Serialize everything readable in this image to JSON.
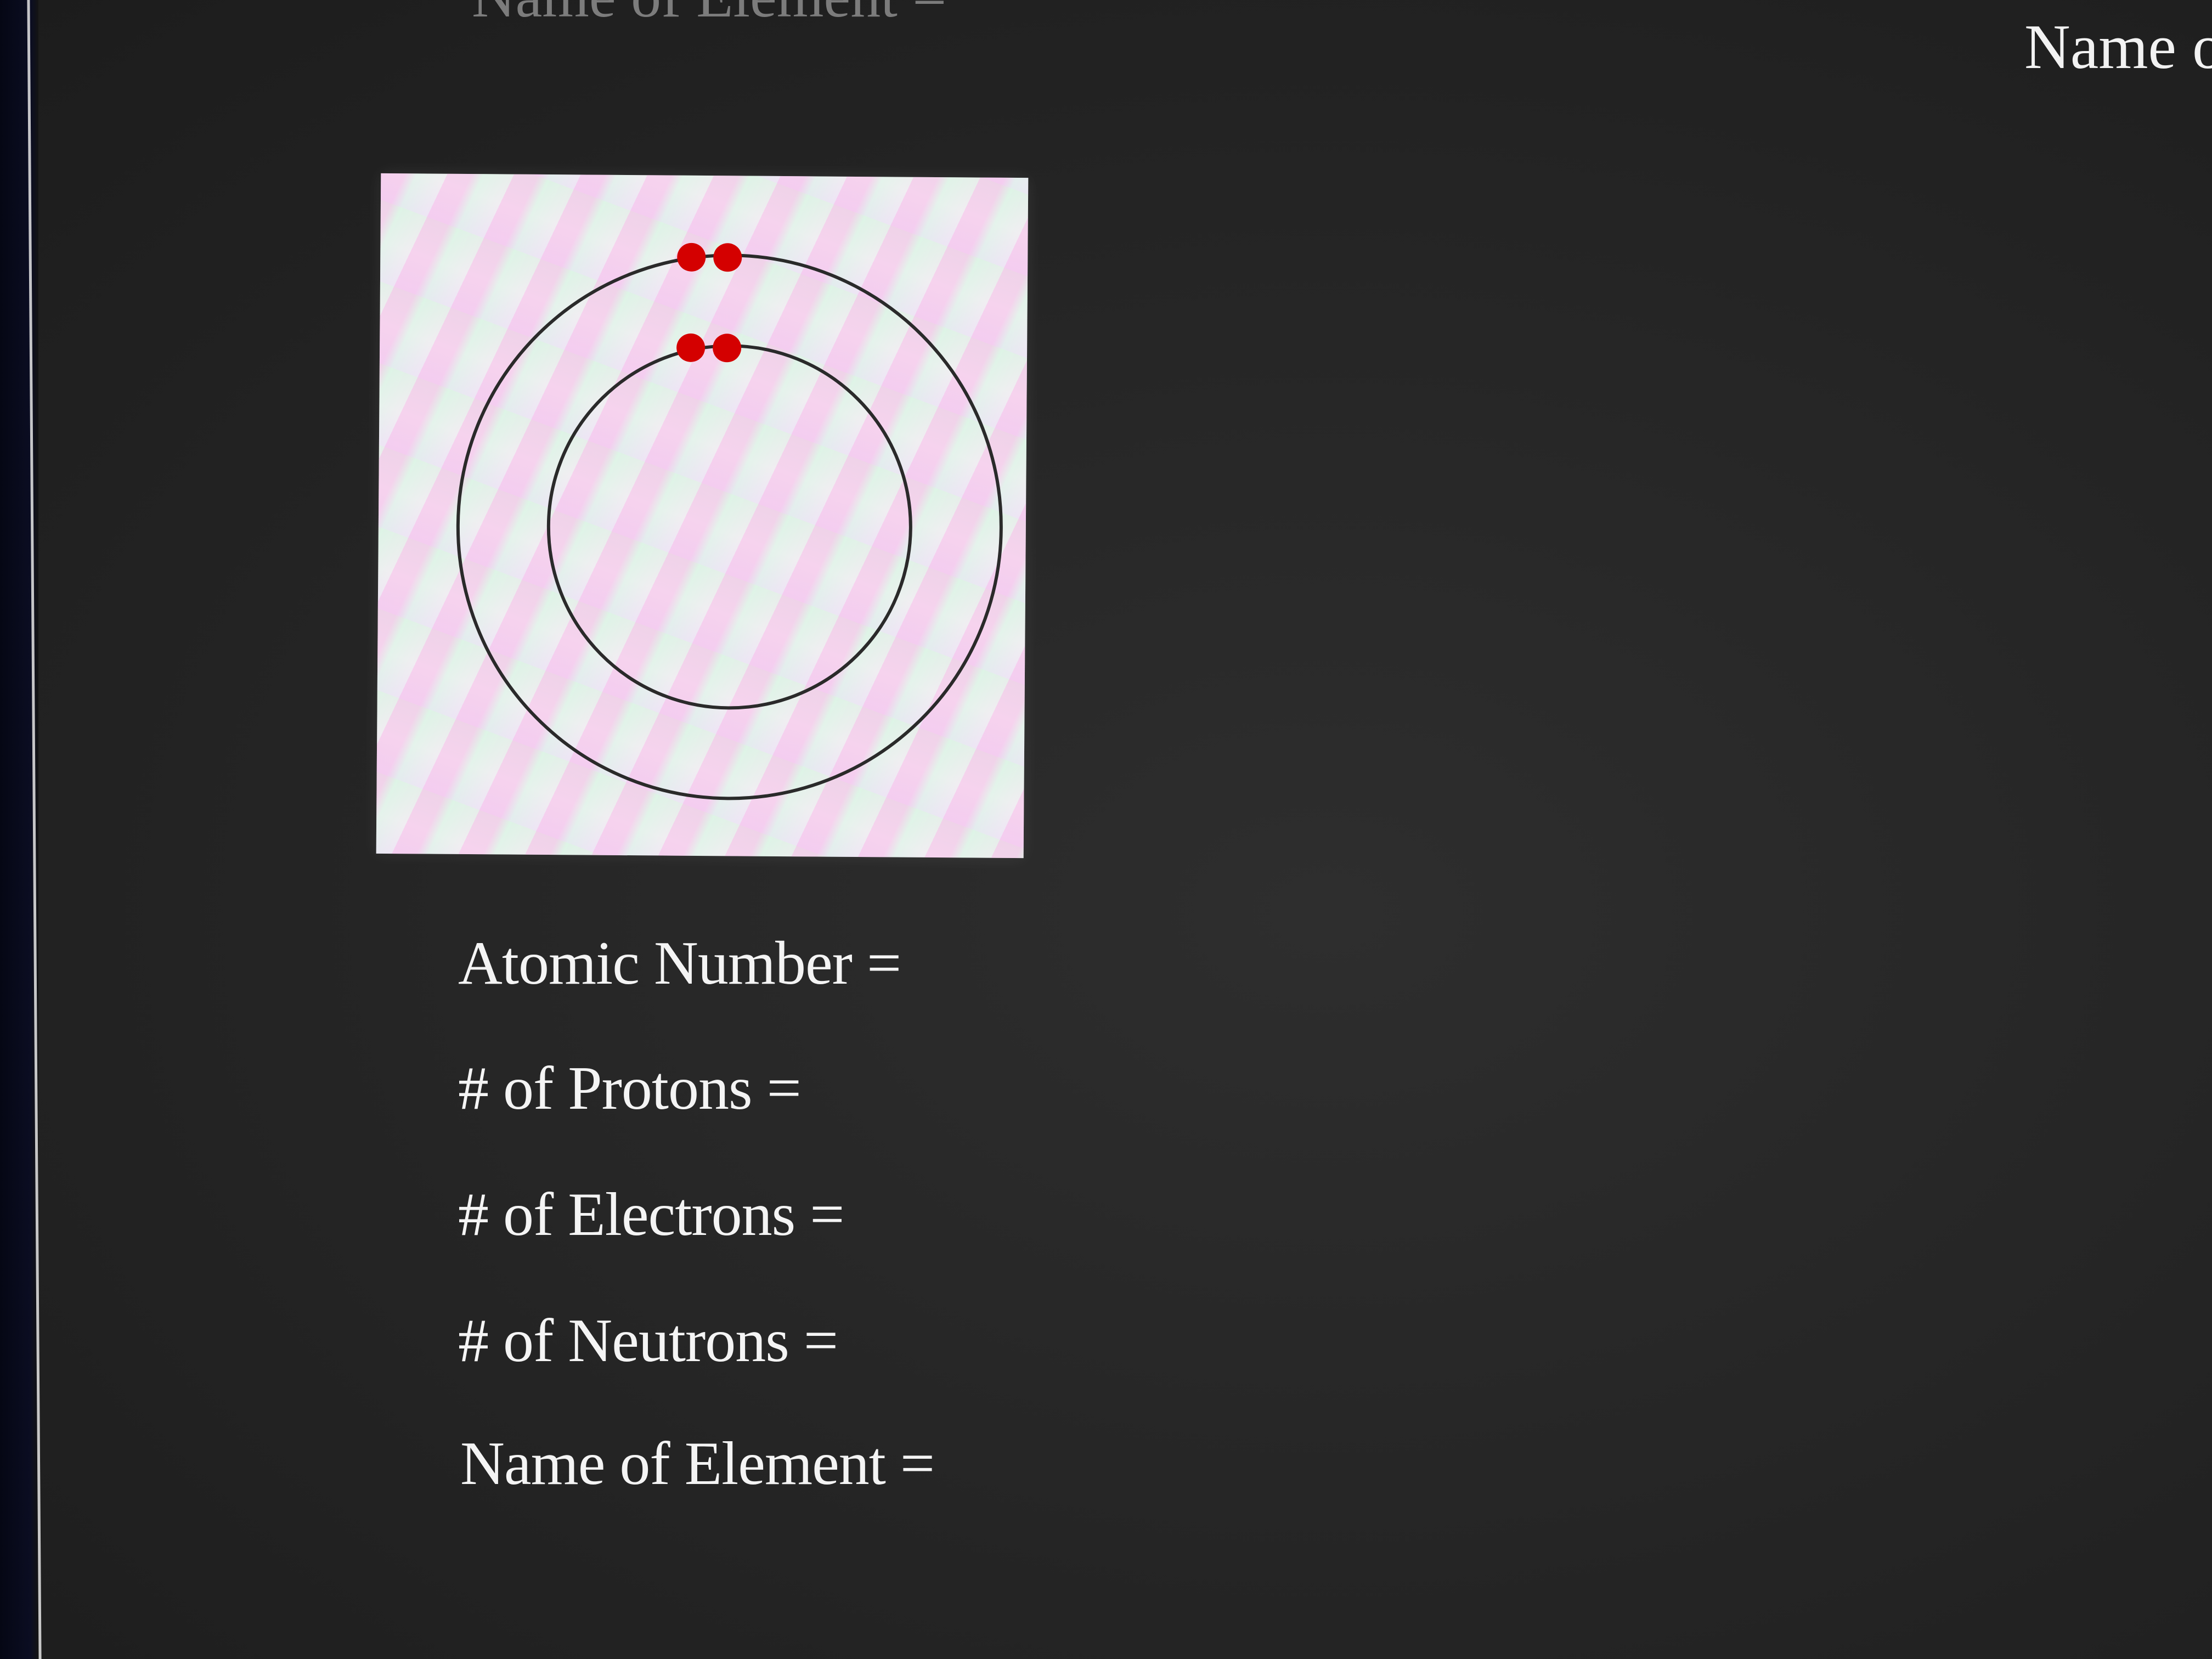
{
  "header": {
    "left_title": "Name of Element =",
    "right_title": "Name o"
  },
  "diagram": {
    "shells": [
      {
        "electrons": 2
      },
      {
        "electrons": 2
      }
    ],
    "electron_color": "#d40000",
    "orbit_color": "#2a2a2a",
    "panel_color": "#f1eef2"
  },
  "fields": [
    {
      "label": "Atomic Number ="
    },
    {
      "label": "# of Protons ="
    },
    {
      "label": "# of Electrons ="
    },
    {
      "label": "# of Neutrons ="
    },
    {
      "label": "Name of Element ="
    }
  ]
}
